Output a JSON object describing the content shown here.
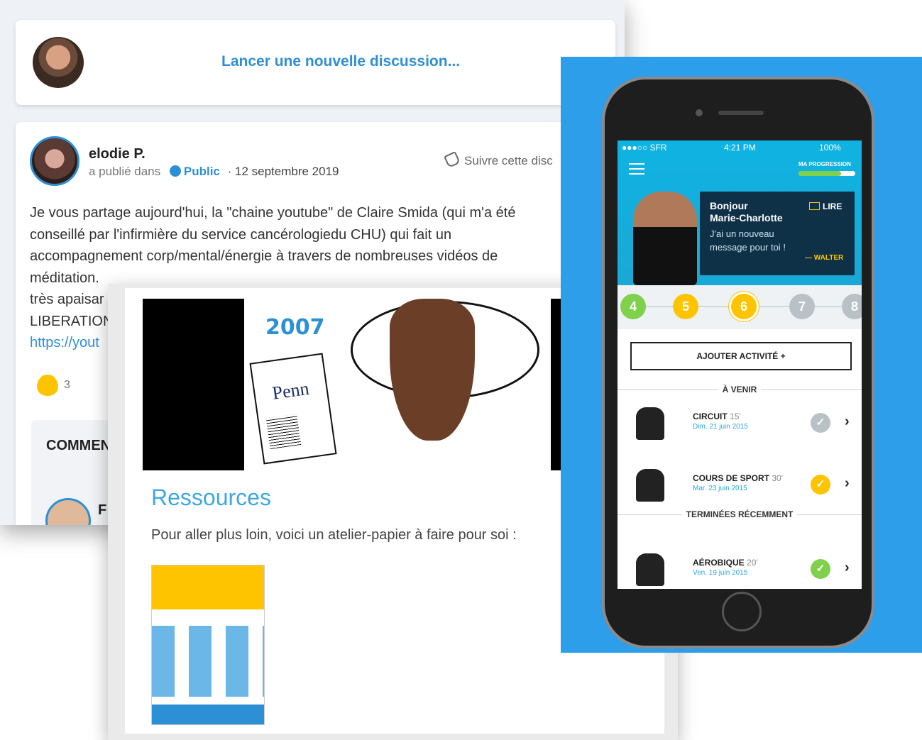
{
  "forum": {
    "new_discussion": "Lancer une nouvelle discussion...",
    "post": {
      "author": "elodie P.",
      "published_in": "a publié dans",
      "audience": "Public",
      "date": "· 12 septembre 2019",
      "follow": "Suivre cette disc",
      "body_lines": [
        "Je vous partage aujourd'hui, la \"chaine youtube\" de Claire Smida (qui m'a été",
        "conseillé par l'infirmière du service cancérologiedu CHU) qui fait un",
        "accompagnement corp/mental/énergie à travers de nombreuses vidéos de",
        "méditation.",
        "très apaisar",
        "LIBERATION"
      ],
      "link": "https://yout",
      "like_count": "3",
      "comments_title": "COMMEN",
      "commenter_initial": "F"
    }
  },
  "resources": {
    "year": "2007",
    "newspaper": "Penn",
    "title": "Ressources",
    "text": "Pour aller plus loin, voici un atelier-papier à faire pour soi :"
  },
  "phone": {
    "status": {
      "carrier": "●●●○○ SFR",
      "time": "4:21 PM",
      "battery": "100%"
    },
    "progress_label": "MA PROGRESSION",
    "progress_fraction": 0.75,
    "message": {
      "greeting": "Bonjour",
      "name": "Marie-Charlotte",
      "read": "LIRE",
      "text_1": "J'ai un nouveau",
      "text_2": "message pour toi !",
      "signature": "— WALTER"
    },
    "steps": [
      {
        "n": "4",
        "color": "#7fd04a"
      },
      {
        "n": "5",
        "color": "#ffc400"
      },
      {
        "n": "6",
        "color": "#ffc400"
      },
      {
        "n": "7",
        "color": "#b8c2c6"
      },
      {
        "n": "8",
        "color": "#b8c2c6"
      }
    ],
    "add_activity": "AJOUTER ACTIVITÉ +",
    "upcoming": "À VENIR",
    "recent": "TERMINÉES RÉCEMMENT",
    "activities": [
      {
        "name": "CIRCUIT",
        "duration": "15'",
        "date": "Dim. 21 juin 2015",
        "check_color": "#b8c2c6"
      },
      {
        "name": "COURS DE SPORT",
        "duration": "30'",
        "date": "Mar. 23 juin 2015",
        "check_color": "#ffc400"
      },
      {
        "name": "AÉROBIQUE",
        "duration": "20'",
        "date": "Ven. 19 juin 2015",
        "check_color": "#7fd04a"
      }
    ]
  }
}
